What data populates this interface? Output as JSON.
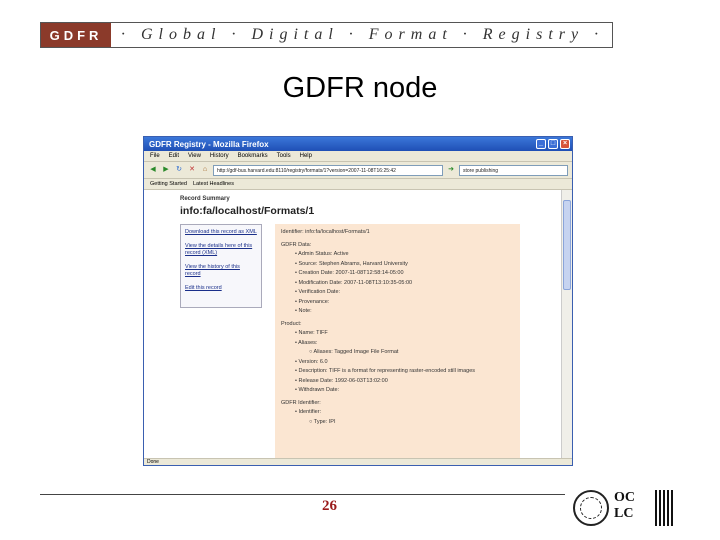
{
  "banner": {
    "logo": "GDFR",
    "tagline": "· Global · Digital · Format · Registry ·"
  },
  "slide_title": "GDFR node",
  "browser": {
    "window_title": "GDFR Registry - Mozilla Firefox",
    "menu": [
      "File",
      "Edit",
      "View",
      "History",
      "Bookmarks",
      "Tools",
      "Help"
    ],
    "url": "http://gdf-bus.harvard.edu:8110/registry/formats/1?version=2007-11-08T16:25:42",
    "search": "store publishing",
    "bookmarks": [
      "Getting Started",
      "Latest Headlines"
    ],
    "status": "Done",
    "page": {
      "summary_label": "Record Summary",
      "record_id": "info:fa/localhost/Formats/1",
      "sidebar_links": [
        "Download this record as XML",
        "View the details here of this record (XML)",
        "View the history of this record",
        "Edit this record"
      ],
      "detail": {
        "identifier": "Identifier: info:fa/localhost/Formats/1",
        "gdfr_data_label": "GDFR Data:",
        "gdfr_data": [
          "Admin Status: Active",
          "Source: Stephen Abrams, Harvard University",
          "Creation Date: 2007-11-08T12:58:14-05:00",
          "Modification Date: 2007-11-08T13:10:35-05:00",
          "Verification Date:",
          "Provenance:",
          "Note:"
        ],
        "product_label": "Product:",
        "product_name": "Name: TIFF",
        "aliases_label": "Aliases:",
        "alias": "Aliases: Tagged Image File Format",
        "product_rest": [
          "Version: 6.0",
          "Description: TIFF is a format for representing raster-encoded still images",
          "Release Date: 1992-06-03T13:02:00",
          "Withdrawn Date:"
        ],
        "identifier_section": "GDFR Identifier:",
        "identifiers_label": "Identifier:",
        "type": "Type: IPI"
      }
    }
  },
  "footer": {
    "page_number": "26",
    "oclc_line1": "OC",
    "oclc_line2": "LC"
  }
}
